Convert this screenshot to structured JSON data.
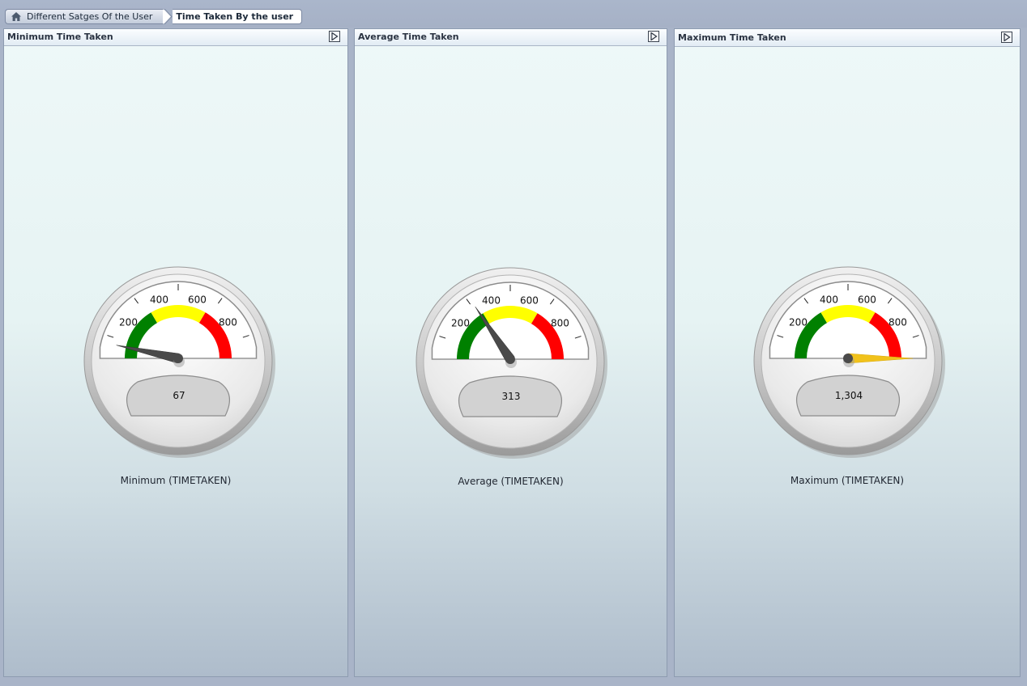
{
  "breadcrumb": {
    "home_label": "Different Satges Of the User",
    "current_label": "Time Taken By the user"
  },
  "panels": [
    {
      "title": "Minimum Time Taken",
      "caption": "Minimum (TIMETAKEN)",
      "value_text": "67",
      "value": 67,
      "needle_color": "#4a4a4a"
    },
    {
      "title": "Average Time Taken",
      "caption": "Average (TIMETAKEN)",
      "value_text": "313",
      "value": 313,
      "needle_color": "#4a4a4a"
    },
    {
      "title": "Maximum Time Taken",
      "caption": "Maximum (TIMETAKEN)",
      "value_text": "1,304",
      "value": 1304,
      "needle_color": "#f1c21b"
    }
  ],
  "gauge": {
    "min": 0,
    "max": 1000,
    "tick_labels": [
      "200",
      "400",
      "600",
      "800"
    ],
    "ranges": [
      {
        "from": 0,
        "to": 330,
        "color": "#008000"
      },
      {
        "from": 330,
        "to": 670,
        "color": "#ffff00"
      },
      {
        "from": 670,
        "to": 1000,
        "color": "#ff0000"
      }
    ]
  },
  "colors": {
    "background": "#a9b4c8",
    "panel_border": "#8d9bb0"
  },
  "icons": {
    "home": "home-icon",
    "panel_action": "collapse-arrow-icon"
  }
}
